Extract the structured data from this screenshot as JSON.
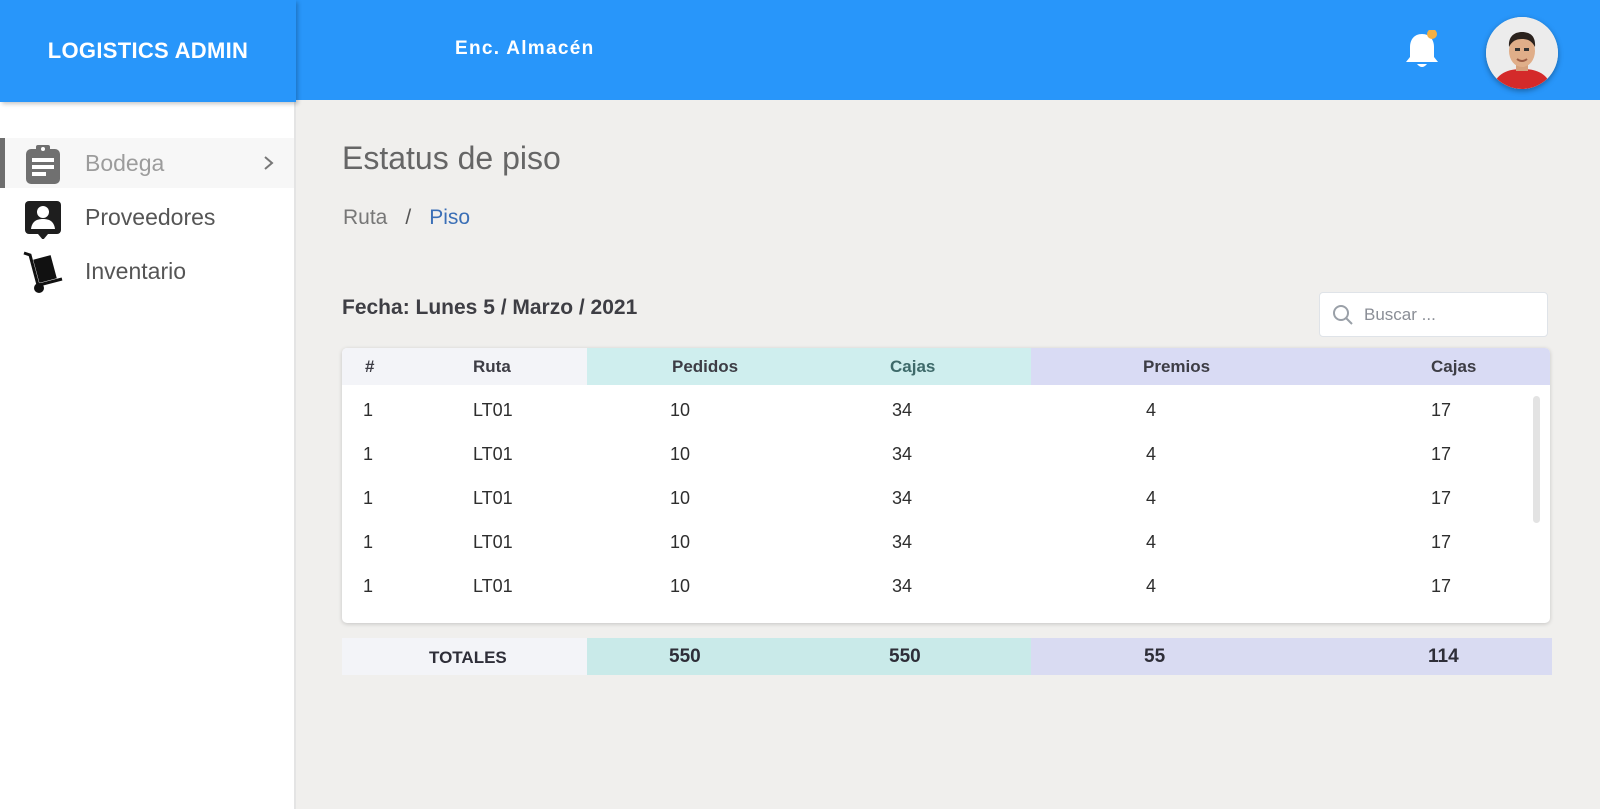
{
  "app": {
    "brand": "LOGISTICS ADMIN",
    "user_role": "Enc. Almacén",
    "accent_color": "#2896fa",
    "notification_icon": "bell-icon",
    "notification_dot_color": "#f5b042"
  },
  "sidebar": {
    "items": [
      {
        "label": "Bodega",
        "icon": "clipboard-icon",
        "active": true,
        "has_submenu": true
      },
      {
        "label": "Proveedores",
        "icon": "contact-card-icon",
        "active": false
      },
      {
        "label": "Inventario",
        "icon": "hand-truck-icon",
        "active": false
      }
    ]
  },
  "page": {
    "title": "Estatus de piso",
    "breadcrumb": [
      "Ruta",
      "Piso"
    ],
    "breadcrumb_separator": "/",
    "date_line": "Fecha: Lunes 5 / Marzo / 2021"
  },
  "search": {
    "placeholder": "Buscar ...",
    "value": ""
  },
  "table": {
    "columns": [
      "#",
      "Ruta",
      "Pedidos",
      "Cajas",
      "Premios",
      "Cajas"
    ],
    "rows": [
      [
        "1",
        "LT01",
        "10",
        "34",
        "4",
        "17"
      ],
      [
        "1",
        "LT01",
        "10",
        "34",
        "4",
        "17"
      ],
      [
        "1",
        "LT01",
        "10",
        "34",
        "4",
        "17"
      ],
      [
        "1",
        "LT01",
        "10",
        "34",
        "4",
        "17"
      ],
      [
        "1",
        "LT01",
        "10",
        "34",
        "4",
        "17"
      ]
    ],
    "totals": {
      "label": "TOTALES",
      "values": [
        "550",
        "550",
        "55",
        "114"
      ]
    },
    "group_colors": {
      "pedidos": "#cfeeee",
      "premios": "#d9dbf4"
    }
  }
}
